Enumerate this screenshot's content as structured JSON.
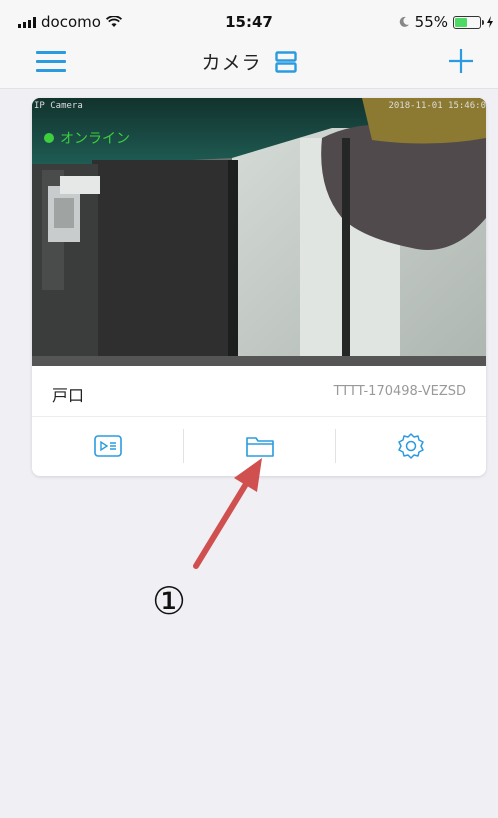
{
  "status_bar": {
    "carrier": "docomo",
    "time": "15:47",
    "battery": "55%",
    "battery_level": 0.55
  },
  "nav": {
    "title": "カメラ",
    "menu_icon": "hamburger-menu-icon",
    "layout_icon": "grid-layout-icon",
    "add_icon": "plus-icon"
  },
  "device_card": {
    "preview_overlay_left": "IP Camera",
    "preview_overlay_right": "2018-11-01 15:46:0",
    "status": "オンライン",
    "name": "戸口",
    "id": "TTTT-170498-VEZSD",
    "actions": [
      "playback-icon",
      "folder-icon",
      "settings-icon"
    ]
  },
  "annotation": {
    "label": "①",
    "color": "#d05050"
  },
  "colors": {
    "accent": "#2a9be0",
    "online": "#3ecf3e",
    "background": "#efeff4"
  }
}
